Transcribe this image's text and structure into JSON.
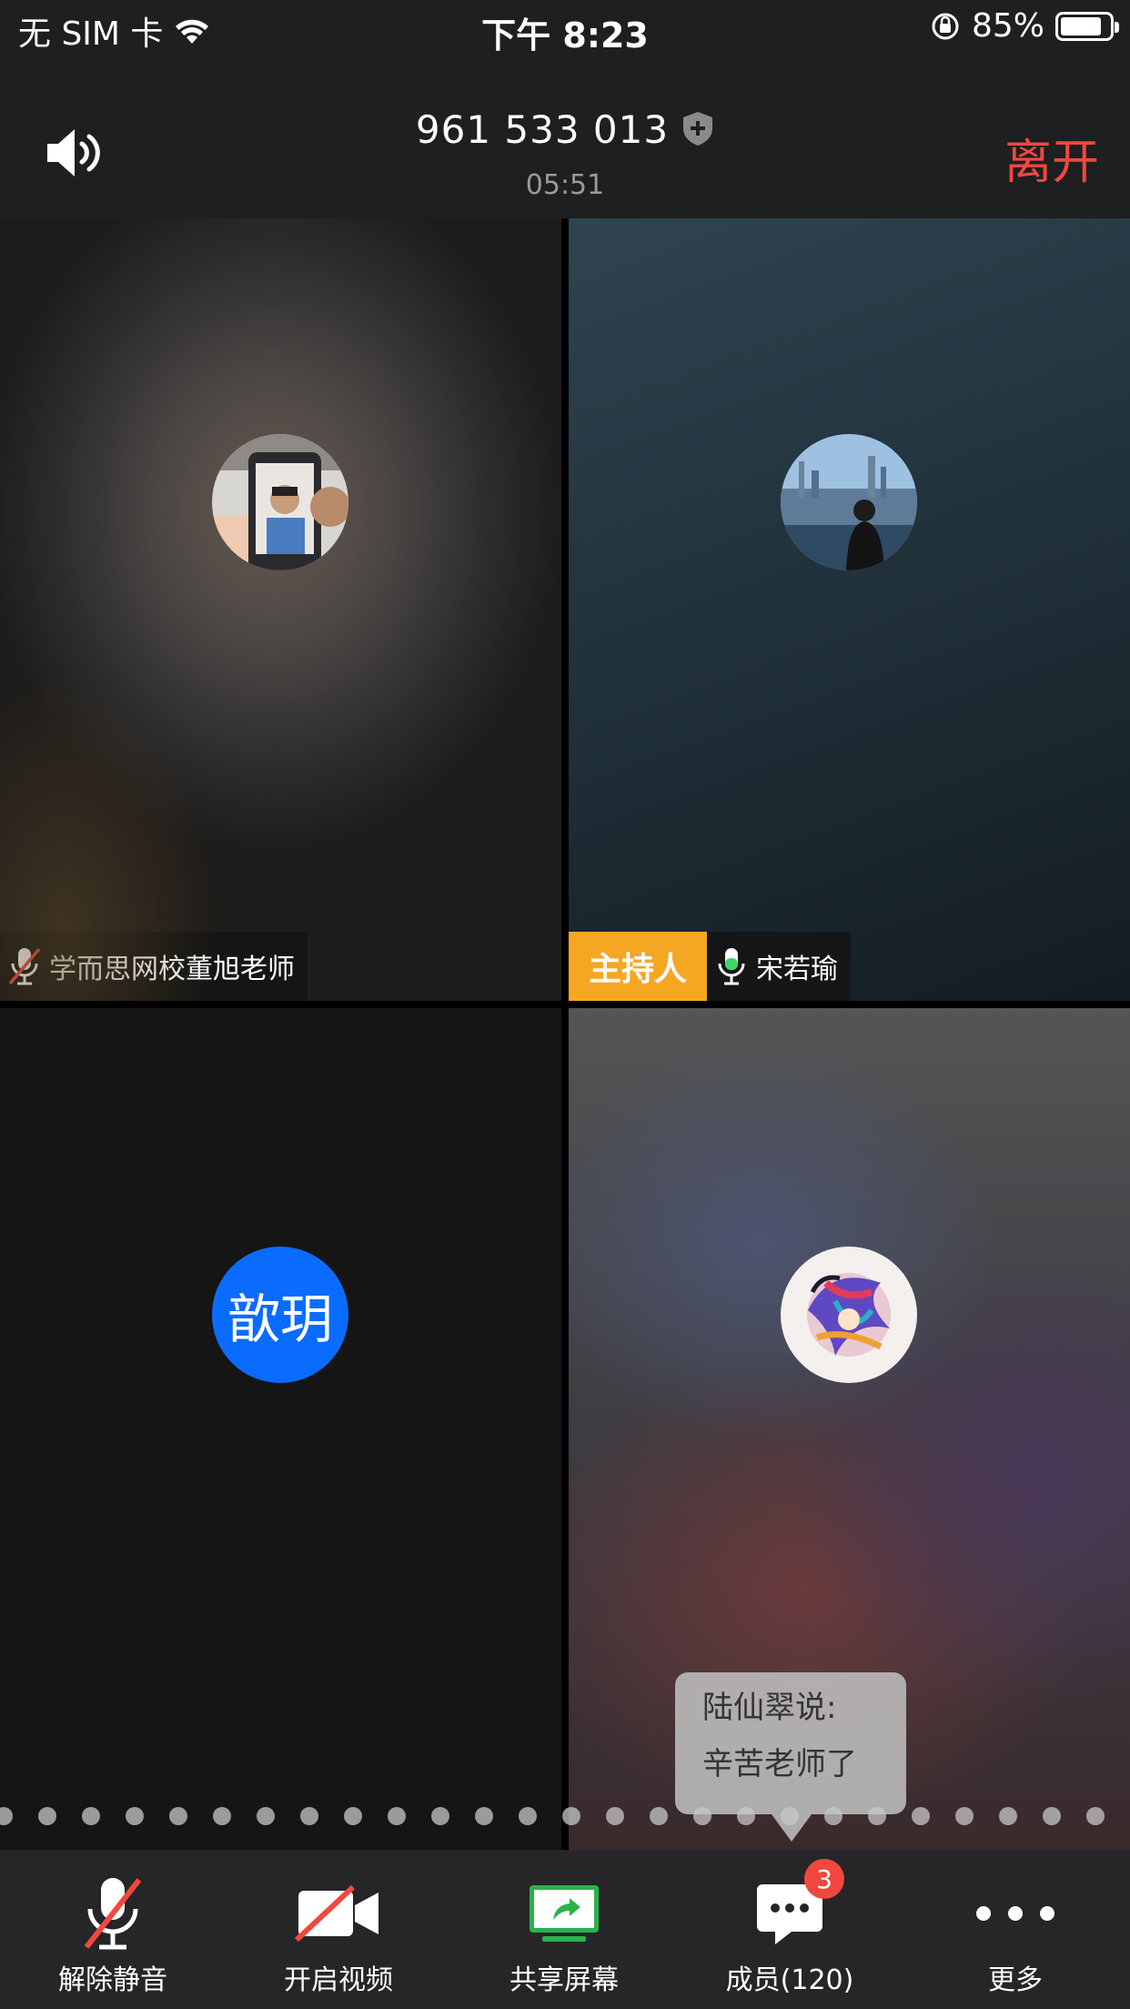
{
  "status_bar": {
    "carrier": "无 SIM 卡",
    "time": "下午 8:23",
    "battery": "85%",
    "battery_level": 0.85
  },
  "header": {
    "meeting_id": "961 533 013",
    "duration": "05:51",
    "leave_label": "离开"
  },
  "participants": [
    {
      "name": "学而思网校董旭老师",
      "muted": true,
      "host": false
    },
    {
      "name": "宋若瑜",
      "muted": false,
      "host": true,
      "host_label": "主持人"
    },
    {
      "name": "",
      "avatar_text": "歆玥",
      "avatar_color": "#0a6cff"
    },
    {
      "name": ""
    }
  ],
  "chat_popup": {
    "line1": "陆仙翠说:",
    "line2": "辛苦老师了"
  },
  "toolbar": {
    "unmute_label": "解除静音",
    "video_label": "开启视频",
    "share_label": "共享屏幕",
    "members_label": "成员(120)",
    "members_badge": "3",
    "more_label": "更多"
  },
  "colors": {
    "leave": "#f0483e",
    "host_badge": "#f5a623",
    "share_green": "#2bb24c",
    "badge_red": "#f0483e"
  }
}
